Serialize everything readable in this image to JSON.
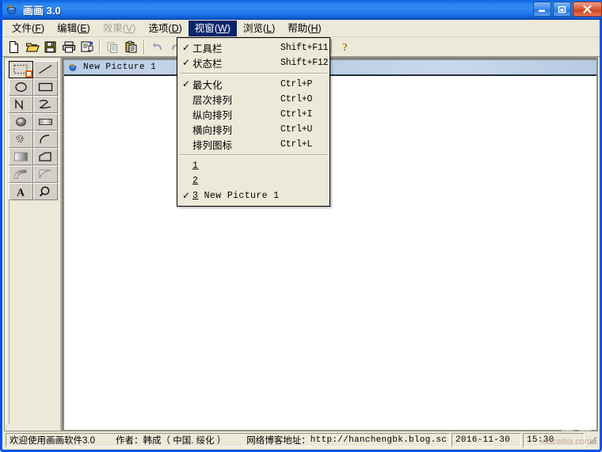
{
  "window": {
    "title": "画画 3.0",
    "icon": "paint-pot-crown-icon",
    "buttons": {
      "minimize": "minimize-button",
      "maximize": "maximize-button",
      "close": "close-button"
    }
  },
  "menubar": {
    "items": [
      {
        "label": "文件",
        "accel": "F",
        "state": "normal"
      },
      {
        "label": "编辑",
        "accel": "E",
        "state": "normal"
      },
      {
        "label": "效果",
        "accel": "V",
        "state": "disabled"
      },
      {
        "label": "选项",
        "accel": "D",
        "state": "normal"
      },
      {
        "label": "视窗",
        "accel": "W",
        "state": "active"
      },
      {
        "label": "浏览",
        "accel": "L",
        "state": "normal"
      },
      {
        "label": "帮助",
        "accel": "H",
        "state": "normal"
      }
    ]
  },
  "toolbar": {
    "buttons": [
      {
        "name": "new-file-icon",
        "enabled": true
      },
      {
        "name": "open-folder-icon",
        "enabled": true
      },
      {
        "name": "save-floppy-icon",
        "enabled": true
      },
      {
        "name": "print-icon",
        "enabled": true
      },
      {
        "name": "print-preview-icon",
        "enabled": true
      },
      {
        "name": "copy-icon",
        "enabled": false
      },
      {
        "name": "paste-icon",
        "enabled": true
      },
      {
        "name": "undo-icon",
        "enabled": false
      },
      {
        "name": "redo-icon",
        "enabled": false
      },
      {
        "name": "swatch-white-icon",
        "enabled": true
      },
      {
        "name": "swatch-gray-icon",
        "enabled": true
      },
      {
        "name": "swatch-gray2-icon",
        "enabled": true
      },
      {
        "name": "fill-color-icon",
        "enabled": true
      },
      {
        "name": "layers-icon",
        "enabled": true
      },
      {
        "name": "lines-icon",
        "enabled": true
      },
      {
        "name": "columns-icon",
        "enabled": true
      },
      {
        "name": "help-question-icon",
        "enabled": true
      }
    ]
  },
  "palette": {
    "name": "tool-palette",
    "tools": [
      {
        "name": "rectangle-select-tool",
        "selected": true
      },
      {
        "name": "line-tool",
        "selected": false
      },
      {
        "name": "ellipse-tool",
        "selected": false
      },
      {
        "name": "rectangle-tool",
        "selected": false
      },
      {
        "name": "polyline-tool",
        "selected": false
      },
      {
        "name": "freehand-tool",
        "selected": false
      },
      {
        "name": "filled-ellipse-tool",
        "selected": false
      },
      {
        "name": "filled-rectangle-tool",
        "selected": false
      },
      {
        "name": "spray-tool",
        "selected": false
      },
      {
        "name": "arc-tool",
        "selected": false
      },
      {
        "name": "gradient-rect-tool",
        "selected": false
      },
      {
        "name": "polygon-tool",
        "selected": false
      },
      {
        "name": "gradient-arc-tool",
        "selected": false
      },
      {
        "name": "gradient-corner-tool",
        "selected": false
      },
      {
        "name": "text-tool",
        "selected": false
      },
      {
        "name": "zoom-tool",
        "selected": false
      }
    ]
  },
  "child_window": {
    "title": "New Picture 1",
    "icon": "paint-pot-crown-icon"
  },
  "dropdown": {
    "owner": "视窗",
    "items": [
      {
        "type": "item",
        "checked": true,
        "label": "工具栏",
        "accel": "Shift+F11",
        "mono": false
      },
      {
        "type": "item",
        "checked": true,
        "label": "状态栏",
        "accel": "Shift+F12",
        "mono": false
      },
      {
        "type": "separator"
      },
      {
        "type": "item",
        "checked": true,
        "label": "最大化",
        "accel": "Ctrl+P",
        "mono": false
      },
      {
        "type": "item",
        "checked": false,
        "label": "层次排列",
        "accel": "Ctrl+O",
        "mono": false
      },
      {
        "type": "item",
        "checked": false,
        "label": "纵向排列",
        "accel": "Ctrl+I",
        "mono": false
      },
      {
        "type": "item",
        "checked": false,
        "label": "横向排列",
        "accel": "Ctrl+U",
        "mono": false
      },
      {
        "type": "item",
        "checked": false,
        "label": "排列图标",
        "accel": "Ctrl+L",
        "mono": false
      },
      {
        "type": "separator"
      },
      {
        "type": "mru",
        "checked": false,
        "num": "1",
        "label": "",
        "accel": "",
        "mono": true
      },
      {
        "type": "mru",
        "checked": false,
        "num": "2",
        "label": "",
        "accel": "",
        "mono": true
      },
      {
        "type": "mru",
        "checked": true,
        "num": "3",
        "label": "New Picture 1",
        "accel": "",
        "mono": true
      }
    ]
  },
  "statusbar": {
    "welcome": "欢迎使用画画软件3.0",
    "author": "作者：韩成（ 中国. 绥化 ）",
    "blog_label": "网络博客地址：",
    "blog_url": "http://hanchengbk.blog.sc",
    "date": "2016-11-30",
    "time": "15:30"
  },
  "watermark": {
    "text": "下载吧",
    "sub": "xiazaiba.com"
  },
  "colors": {
    "titlebar_blue": "#2f87f0",
    "menu_highlight": "#0a246a",
    "face": "#ece9d8",
    "mdi_back": "#808080",
    "child_title": "#b8cce4"
  }
}
